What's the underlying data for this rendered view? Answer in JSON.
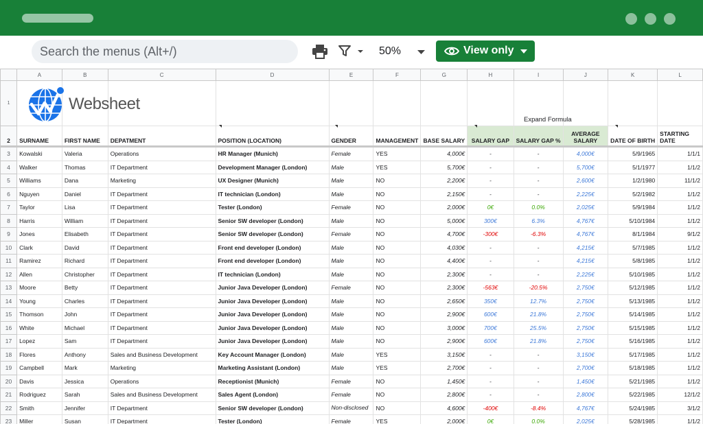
{
  "search": {
    "placeholder": "Search the menus (Alt+/)"
  },
  "toolbar": {
    "zoom": "50%",
    "view_label": "View only"
  },
  "logo": {
    "text": "Websheet"
  },
  "expand_label": "Expand Formula",
  "columns": [
    "A",
    "B",
    "C",
    "D",
    "E",
    "F",
    "G",
    "H",
    "I",
    "J",
    "K",
    "L"
  ],
  "headers": [
    "SURNAME",
    "FIRST NAME",
    "DEPATMENT",
    "POSITION (LOCATION)",
    "GENDER",
    "MANAGEMENT",
    "BASE SALARY",
    "SALARY GAP",
    "SALARY GAP %",
    "AVERAGE SALARY",
    "DATE OF BIRTH",
    "STARTING DATE"
  ],
  "header_row_num": "2",
  "logo_row_num": "1",
  "rows": [
    {
      "n": "3",
      "surname": "Kowalski",
      "first": "Valeria",
      "dept": "Operations",
      "pos": "HR Manager (Munich)",
      "gender": "Female",
      "mgmt": "YES",
      "base": "4,000€",
      "gap": "-",
      "gappct": "-",
      "avg": "4,000€",
      "dob": "5/9/1965",
      "start": "1/1/1"
    },
    {
      "n": "4",
      "surname": "Walker",
      "first": "Thomas",
      "dept": "IT Department",
      "pos": "Development Manager (London)",
      "gender": "Male",
      "mgmt": "YES",
      "base": "5,700€",
      "gap": "-",
      "gappct": "-",
      "avg": "5,700€",
      "dob": "5/1/1977",
      "start": "1/1/2"
    },
    {
      "n": "5",
      "surname": "Williams",
      "first": "Dana",
      "dept": "Marketing",
      "pos": "UX Designer (Munich)",
      "gender": "Male",
      "mgmt": "NO",
      "base": "2,200€",
      "gap": "-",
      "gappct": "-",
      "avg": "2,600€",
      "dob": "1/2/1980",
      "start": "11/1/2"
    },
    {
      "n": "6",
      "surname": "Nguyen",
      "first": "Daniel",
      "dept": "IT Department",
      "pos": "IT technician (London)",
      "gender": "Male",
      "mgmt": "NO",
      "base": "2,150€",
      "gap": "-",
      "gappct": "-",
      "avg": "2,225€",
      "dob": "5/2/1982",
      "start": "1/1/2"
    },
    {
      "n": "7",
      "surname": "Taylor",
      "first": "Lisa",
      "dept": "IT Department",
      "pos": "Tester (London)",
      "gender": "Female",
      "mgmt": "NO",
      "base": "2,000€",
      "gap": "0€",
      "gappct": "0.0%",
      "avg": "2,025€",
      "dob": "5/9/1984",
      "start": "1/1/2",
      "tone": "green"
    },
    {
      "n": "8",
      "surname": "Harris",
      "first": "William",
      "dept": "IT Department",
      "pos": "Senior SW developer (London)",
      "gender": "Male",
      "mgmt": "NO",
      "base": "5,000€",
      "gap": "300€",
      "gappct": "6.3%",
      "avg": "4,767€",
      "dob": "5/10/1984",
      "start": "1/1/2",
      "tone": "blue"
    },
    {
      "n": "9",
      "surname": "Jones",
      "first": "Elisabeth",
      "dept": "IT Department",
      "pos": "Senior SW developer (London)",
      "gender": "Female",
      "mgmt": "NO",
      "base": "4,700€",
      "gap": "-300€",
      "gappct": "-6.3%",
      "avg": "4,767€",
      "dob": "8/1/1984",
      "start": "9/1/2",
      "tone": "red"
    },
    {
      "n": "10",
      "surname": "Clark",
      "first": "David",
      "dept": "IT Department",
      "pos": "Front end developer (London)",
      "gender": "Male",
      "mgmt": "NO",
      "base": "4,030€",
      "gap": "-",
      "gappct": "-",
      "avg": "4,215€",
      "dob": "5/7/1985",
      "start": "1/1/2"
    },
    {
      "n": "11",
      "surname": "Ramirez",
      "first": "Richard",
      "dept": "IT Department",
      "pos": "Front end developer (London)",
      "gender": "Male",
      "mgmt": "NO",
      "base": "4,400€",
      "gap": "-",
      "gappct": "-",
      "avg": "4,215€",
      "dob": "5/8/1985",
      "start": "1/1/2"
    },
    {
      "n": "12",
      "surname": "Allen",
      "first": "Christopher",
      "dept": "IT Department",
      "pos": "IT technician (London)",
      "gender": "Male",
      "mgmt": "NO",
      "base": "2,300€",
      "gap": "-",
      "gappct": "-",
      "avg": "2,225€",
      "dob": "5/10/1985",
      "start": "1/1/2"
    },
    {
      "n": "13",
      "surname": "Moore",
      "first": "Betty",
      "dept": "IT Department",
      "pos": "Junior Java Developer (London)",
      "gender": "Female",
      "mgmt": "NO",
      "base": "2,300€",
      "gap": "-563€",
      "gappct": "-20.5%",
      "avg": "2,750€",
      "dob": "5/12/1985",
      "start": "1/1/2",
      "tone": "red"
    },
    {
      "n": "14",
      "surname": "Young",
      "first": "Charles",
      "dept": "IT Department",
      "pos": "Junior Java Developer (London)",
      "gender": "Male",
      "mgmt": "NO",
      "base": "2,650€",
      "gap": "350€",
      "gappct": "12.7%",
      "avg": "2,750€",
      "dob": "5/13/1985",
      "start": "1/1/2",
      "tone": "blue"
    },
    {
      "n": "15",
      "surname": "Thomson",
      "first": "John",
      "dept": "IT Department",
      "pos": "Junior Java Developer (London)",
      "gender": "Male",
      "mgmt": "NO",
      "base": "2,900€",
      "gap": "600€",
      "gappct": "21.8%",
      "avg": "2,750€",
      "dob": "5/14/1985",
      "start": "1/1/2",
      "tone": "blue"
    },
    {
      "n": "16",
      "surname": "White",
      "first": "Michael",
      "dept": "IT Department",
      "pos": "Junior Java Developer (London)",
      "gender": "Male",
      "mgmt": "NO",
      "base": "3,000€",
      "gap": "700€",
      "gappct": "25.5%",
      "avg": "2,750€",
      "dob": "5/15/1985",
      "start": "1/1/2",
      "tone": "blue"
    },
    {
      "n": "17",
      "surname": "Lopez",
      "first": "Sam",
      "dept": "IT Department",
      "pos": "Junior Java Developer (London)",
      "gender": "Male",
      "mgmt": "NO",
      "base": "2,900€",
      "gap": "600€",
      "gappct": "21.8%",
      "avg": "2,750€",
      "dob": "5/16/1985",
      "start": "1/1/2",
      "tone": "blue"
    },
    {
      "n": "18",
      "surname": "Flores",
      "first": "Anthony",
      "dept": "Sales and Business Development",
      "pos": "Key Account Manager (London)",
      "gender": "Male",
      "mgmt": "YES",
      "base": "3,150€",
      "gap": "-",
      "gappct": "-",
      "avg": "3,150€",
      "dob": "5/17/1985",
      "start": "1/1/2"
    },
    {
      "n": "19",
      "surname": "Campbell",
      "first": "Mark",
      "dept": "Marketing",
      "pos": "Marketing Assistant (London)",
      "gender": "Male",
      "mgmt": "YES",
      "base": "2,700€",
      "gap": "-",
      "gappct": "-",
      "avg": "2,700€",
      "dob": "5/18/1985",
      "start": "1/1/2"
    },
    {
      "n": "20",
      "surname": "Davis",
      "first": "Jessica",
      "dept": "Operations",
      "pos": "Receptionist (Munich)",
      "gender": "Female",
      "mgmt": "NO",
      "base": "1,450€",
      "gap": "-",
      "gappct": "-",
      "avg": "1,450€",
      "dob": "5/21/1985",
      "start": "1/1/2"
    },
    {
      "n": "21",
      "surname": "Rodriguez",
      "first": "Sarah",
      "dept": "Sales and Business Development",
      "pos": "Sales Agent (London)",
      "gender": "Female",
      "mgmt": "NO",
      "base": "2,800€",
      "gap": "-",
      "gappct": "-",
      "avg": "2,800€",
      "dob": "5/22/1985",
      "start": "12/1/2"
    },
    {
      "n": "22",
      "surname": "Smith",
      "first": "Jennifer",
      "dept": "IT Department",
      "pos": "Senior SW developer (London)",
      "gender": "Non-disclosed",
      "mgmt": "NO",
      "base": "4,600€",
      "gap": "-400€",
      "gappct": "-8.4%",
      "avg": "4,767€",
      "dob": "5/24/1985",
      "start": "3/1/2",
      "tone": "red"
    },
    {
      "n": "23",
      "surname": "Miller",
      "first": "Susan",
      "dept": "IT Department",
      "pos": "Tester (London)",
      "gender": "Female",
      "mgmt": "YES",
      "base": "2,000€",
      "gap": "0€",
      "gappct": "0.0%",
      "avg": "2,025€",
      "dob": "5/28/1985",
      "start": "1/1/2",
      "tone": "green"
    }
  ],
  "colors": {
    "brand": "#188038",
    "gap_header": "#d9ead3",
    "positive": "#3c78d8",
    "negative": "#e00000",
    "zero": "#38a600"
  }
}
